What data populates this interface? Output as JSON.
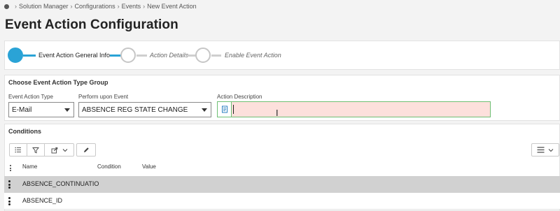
{
  "breadcrumb": {
    "items": [
      "Solution Manager",
      "Configurations",
      "Events",
      "New Event Action"
    ]
  },
  "page": {
    "title": "Event Action Configuration"
  },
  "wizard": {
    "steps": [
      {
        "label": "Event Action General Info",
        "state": "active"
      },
      {
        "label": "Action Details",
        "state": "inactive"
      },
      {
        "label": "Enable Event Action",
        "state": "inactive"
      }
    ]
  },
  "type_group": {
    "title": "Choose Event Action Type Group",
    "fields": {
      "event_action_type": {
        "label": "Event Action Type",
        "value": "E-Mail"
      },
      "perform_upon_event": {
        "label": "Perform upon Event",
        "value": "ABSENCE REG STATE CHANGE"
      },
      "action_description": {
        "label": "Action Description",
        "value": ""
      }
    }
  },
  "conditions": {
    "title": "Conditions",
    "columns": [
      "Name",
      "Condition",
      "Value"
    ],
    "rows": [
      {
        "name": "ABSENCE_CONTINUATIO",
        "condition": "",
        "value": "",
        "selected": true
      },
      {
        "name": "ABSENCE_ID",
        "condition": "",
        "value": "",
        "selected": false
      }
    ]
  },
  "colors": {
    "accent": "#2aa3d6",
    "invalid_bg": "#fde0dc",
    "valid_border": "#6fbf73",
    "selected_row": "#d1d1d1"
  },
  "icons": {
    "home": "home-dot-icon",
    "list": "list-icon",
    "filter": "filter-icon",
    "export": "export-icon",
    "edit": "pencil-icon",
    "table_menu": "table-menu-icon",
    "row_menu": "kebab-icon",
    "notes": "notes-icon"
  }
}
